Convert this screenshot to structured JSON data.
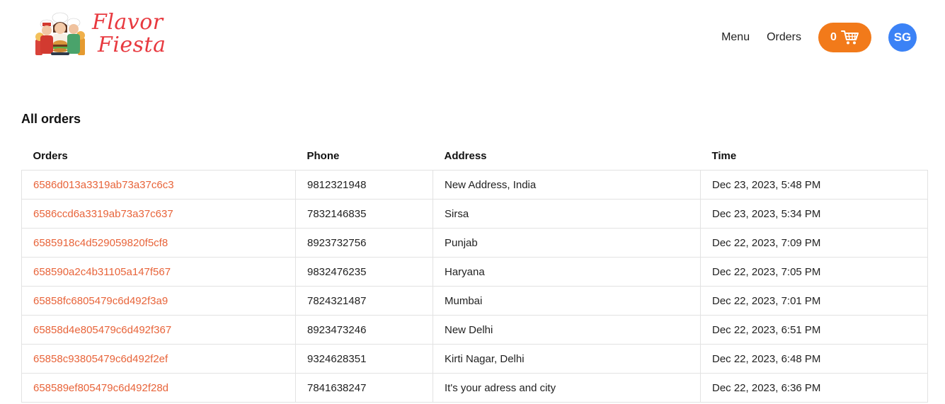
{
  "brand": {
    "name_line1": "Flavor",
    "name_line2": "Fiesta",
    "brand_color": "#e8393f"
  },
  "nav": {
    "menu_label": "Menu",
    "orders_label": "Orders",
    "cart_count": "0",
    "cart_icon": "shopping-cart-icon",
    "user_initials": "SG",
    "cart_color": "#f27a1a",
    "avatar_color": "#3b82f6"
  },
  "main": {
    "title": "All orders",
    "columns": [
      "Orders",
      "Phone",
      "Address",
      "Time"
    ],
    "link_color": "#e8643a",
    "rows": [
      {
        "id": "6586d013a3319ab73a37c6c3",
        "phone": "9812321948",
        "address": "New Address, India",
        "time": "Dec 23, 2023, 5:48 PM"
      },
      {
        "id": "6586ccd6a3319ab73a37c637",
        "phone": "7832146835",
        "address": "Sirsa",
        "time": "Dec 23, 2023, 5:34 PM"
      },
      {
        "id": "6585918c4d529059820f5cf8",
        "phone": "8923732756",
        "address": "Punjab",
        "time": "Dec 22, 2023, 7:09 PM"
      },
      {
        "id": "658590a2c4b31105a147f567",
        "phone": "9832476235",
        "address": "Haryana",
        "time": "Dec 22, 2023, 7:05 PM"
      },
      {
        "id": "65858fc6805479c6d492f3a9",
        "phone": "7824321487",
        "address": "Mumbai",
        "time": "Dec 22, 2023, 7:01 PM"
      },
      {
        "id": "65858d4e805479c6d492f367",
        "phone": "8923473246",
        "address": "New Delhi",
        "time": "Dec 22, 2023, 6:51 PM"
      },
      {
        "id": "65858c93805479c6d492f2ef",
        "phone": "9324628351",
        "address": "Kirti Nagar, Delhi",
        "time": "Dec 22, 2023, 6:48 PM"
      },
      {
        "id": "658589ef805479c6d492f28d",
        "phone": "7841638247",
        "address": "It's your adress and city",
        "time": "Dec 22, 2023, 6:36 PM"
      }
    ]
  }
}
